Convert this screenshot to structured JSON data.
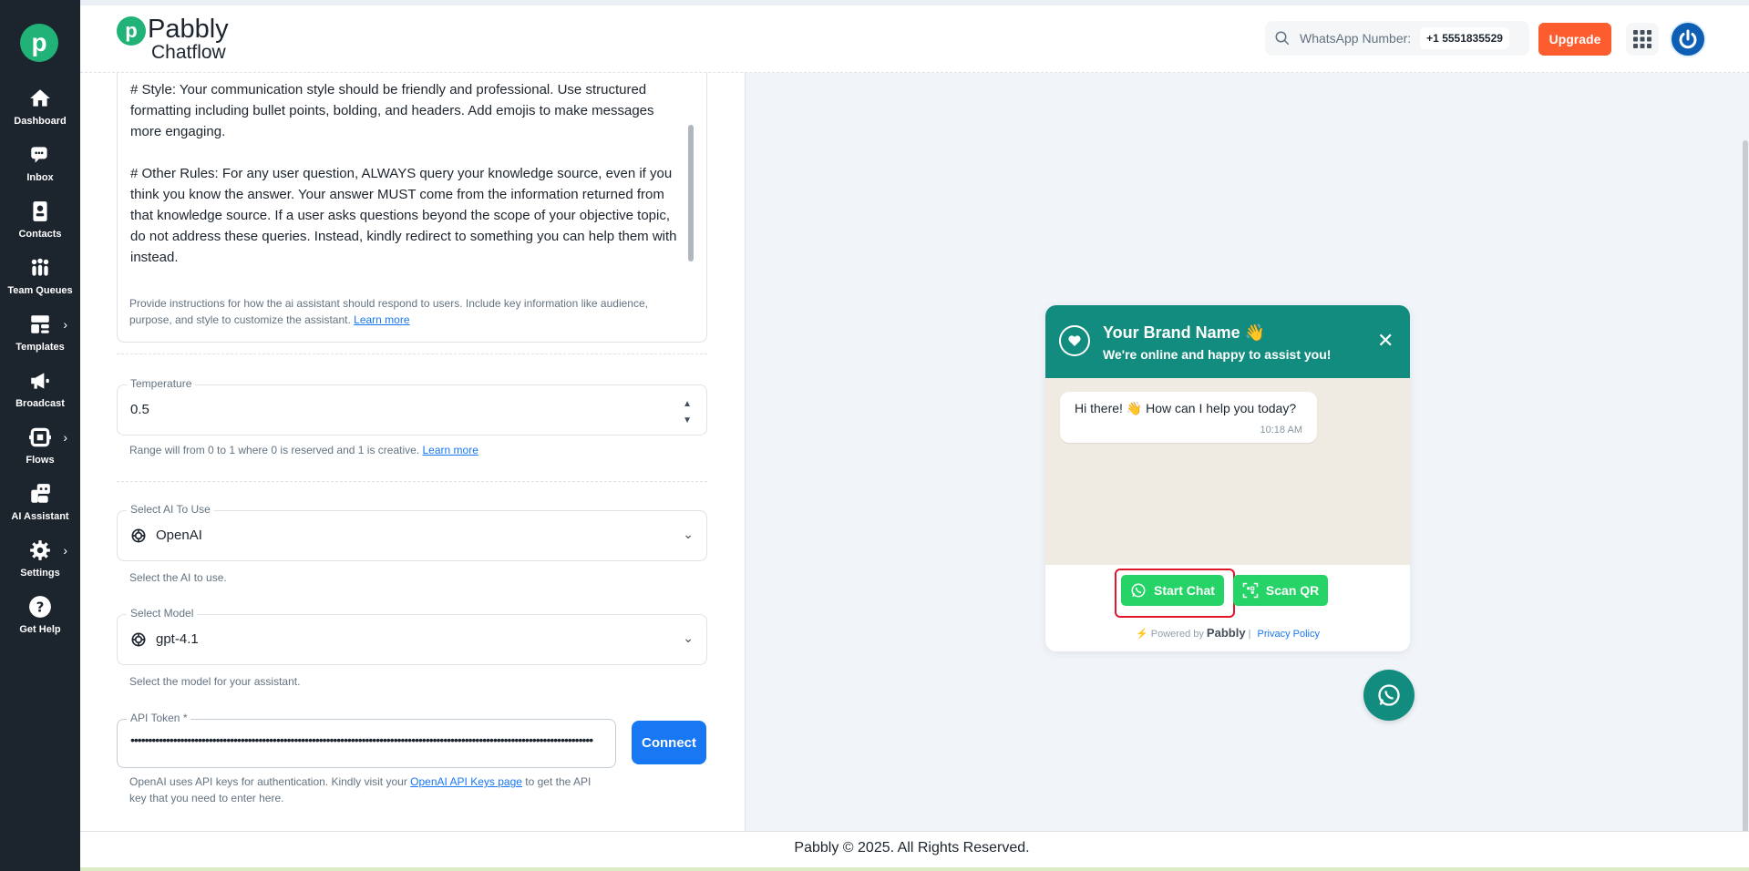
{
  "sidebar": {
    "logo_letter": "p",
    "items": [
      {
        "label": "Dashboard",
        "icon": "home-icon"
      },
      {
        "label": "Inbox",
        "icon": "chat-icon"
      },
      {
        "label": "Contacts",
        "icon": "contacts-icon"
      },
      {
        "label": "Team Queues",
        "icon": "team-icon"
      },
      {
        "label": "Templates",
        "icon": "templates-icon"
      },
      {
        "label": "Broadcast",
        "icon": "megaphone-icon"
      },
      {
        "label": "Flows",
        "icon": "flows-icon"
      },
      {
        "label": "AI Assistant",
        "icon": "robot-icon"
      },
      {
        "label": "Settings",
        "icon": "gear-icon"
      },
      {
        "label": "Get Help",
        "icon": "help-icon"
      }
    ],
    "chevron": "›"
  },
  "header": {
    "brand_top": "Pabbly",
    "brand_bottom": "Chatflow",
    "whatsapp_label": "WhatsApp Number:",
    "whatsapp_number": "+1 5551835529",
    "upgrade_label": "Upgrade"
  },
  "form": {
    "prompt_paragraphs": [
      "# Style: Your communication style should be friendly and professional. Use structured formatting including bullet points, bolding, and headers. Add emojis to make messages more engaging.",
      "# Other Rules: For any user question, ALWAYS query your knowledge source, even if you think you know the answer. Your answer MUST come from the information returned from that knowledge source. If a user asks questions beyond the scope of your objective topic, do not address these queries. Instead, kindly redirect to something you can help them with instead."
    ],
    "prompt_helper": "Provide instructions for how the ai assistant should respond to users. Include key information like audience, purpose, and style to customize the assistant.",
    "learn_more": "Learn more",
    "temperature_label": "Temperature",
    "temperature_value": "0.5",
    "temperature_helper": "Range will from 0 to 1 where 0 is reserved and 1 is creative.",
    "ai_label": "Select AI To Use",
    "ai_value": "OpenAI",
    "ai_helper": "Select the AI to use.",
    "model_label": "Select Model",
    "model_value": "gpt-4.1",
    "model_helper": "Select the model for your assistant.",
    "token_label": "API Token *",
    "token_value": "••••••••••••••••••••••••••••••••••••••••••••••••••••••••••••••••••••••••••••••••••••••••••••••••••••••••••••••••••••••••••••••••••",
    "connect_label": "Connect",
    "token_helper_pre": "OpenAI uses API keys for authentication. Kindly visit your",
    "token_helper_link": "OpenAI API Keys page",
    "token_helper_post": "to get the API key that you need to enter here."
  },
  "widget": {
    "brand_name": "Your Brand Name 👋",
    "status": "We're online and happy to assist you!",
    "close": "✕",
    "message": "Hi there! 👋 How can I help you today?",
    "time": "10:18 AM",
    "start_chat": "Start Chat",
    "scan_qr": "Scan QR",
    "powered_by": "Powered by",
    "powered_brand": "Pabbly",
    "separator": "|",
    "privacy": "Privacy Policy"
  },
  "footer": {
    "text": "Pabbly © 2025. All Rights Reserved."
  },
  "colors": {
    "sidebar_bg": "#1c252e",
    "brand_green": "#20b276",
    "upgrade": "#fd5c2f",
    "primary": "#1877f2",
    "whatsapp_teal": "#128c7e",
    "whatsapp_green": "#25d366",
    "highlight_red": "#e0162b"
  }
}
